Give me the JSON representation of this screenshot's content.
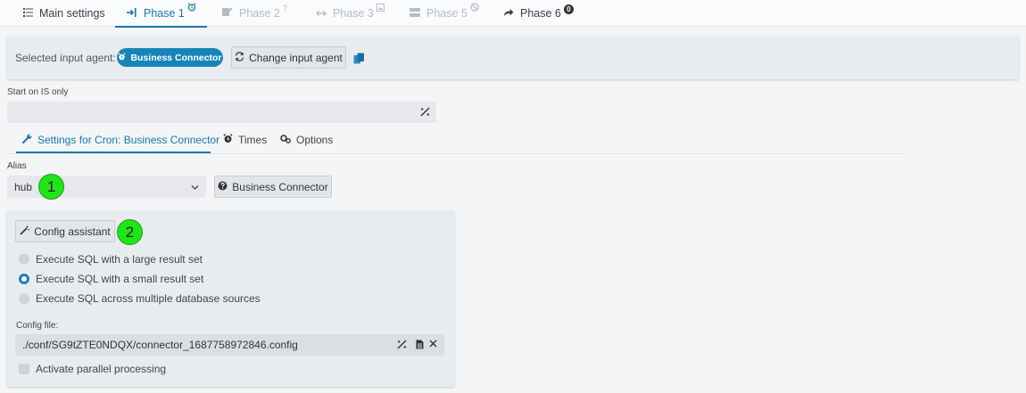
{
  "phase_tabs": [
    {
      "label": "Main settings",
      "icon": "list-icon",
      "state": "normal"
    },
    {
      "label": "Phase 1",
      "icon": "sign-in-icon",
      "badge": "alarm-clock-icon",
      "state": "active"
    },
    {
      "label": "Phase 2",
      "icon": "edit-icon",
      "badge": "?",
      "state": "disabled"
    },
    {
      "label": "Phase 3",
      "icon": "arrows-h-icon",
      "badge": "image-icon",
      "state": "disabled"
    },
    {
      "label": "Phase 5",
      "icon": "server-icon",
      "badge": "ban-icon",
      "state": "disabled"
    },
    {
      "label": "Phase 6",
      "icon": "share-icon",
      "badge": "0",
      "state": "normal"
    }
  ],
  "agent": {
    "label": "Selected input agent:",
    "selected": "Business Connector",
    "change_label": "Change input agent"
  },
  "start_on_is": {
    "label": "Start on IS only",
    "value": ""
  },
  "settings_tabs": [
    {
      "label": "Settings for Cron: Business Connector",
      "icon": "wrench-icon",
      "active": true
    },
    {
      "label": "Times",
      "icon": "alarm-clock-icon",
      "active": false
    },
    {
      "label": "Options",
      "icon": "cogs-icon",
      "active": false
    }
  ],
  "alias": {
    "label": "Alias",
    "value": "hub",
    "info_button_label": "Business Connector"
  },
  "markers": [
    "1",
    "2"
  ],
  "config": {
    "assistant_label": "Config assistant",
    "options": [
      {
        "label": "Execute SQL with a large result set",
        "selected": false
      },
      {
        "label": "Execute SQL with a small result set",
        "selected": true
      },
      {
        "label": "Execute SQL across multiple database sources",
        "selected": false
      }
    ],
    "file_label": "Config file:",
    "file_value": "./conf/SG9tZTE0NDQX/connector_1687758972846.config",
    "parallel_label": "Activate parallel processing",
    "parallel_checked": false
  },
  "colors": {
    "accent": "#1779a6",
    "pill": "#1784b8",
    "marker": "#21e41a",
    "panel": "#e9ecee"
  }
}
